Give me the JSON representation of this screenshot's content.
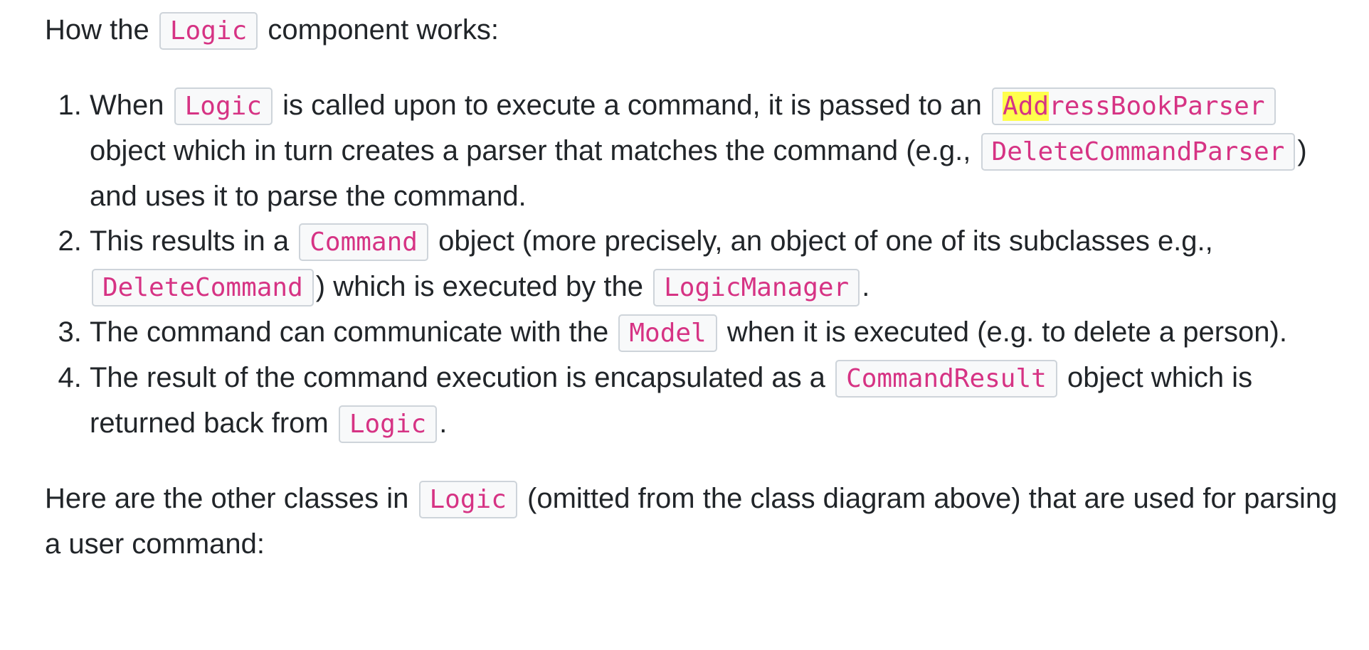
{
  "intro": {
    "before": "How the",
    "code": "Logic",
    "after": "component works:"
  },
  "steps": [
    {
      "t1": "When",
      "c1": "Logic",
      "t2": "is called upon to execute a command, it is passed to an",
      "c2_highlight": "Add",
      "c2_rest": "ressBookParser",
      "t3": "object which in turn creates a parser that matches the command (e.g.,",
      "c3": "DeleteCommandParser",
      "t4": ") and uses it to parse the command."
    },
    {
      "t1": "This results in a",
      "c1": "Command",
      "t2": "object (more precisely, an object of one of its subclasses e.g.,",
      "c2": "DeleteCommand",
      "t3": ") which is executed by the",
      "c3": "LogicManager",
      "t4": "."
    },
    {
      "t1": "The command can communicate with the",
      "c1": "Model",
      "t2": "when it is executed (e.g. to delete a person)."
    },
    {
      "t1": "The result of the command execution is encapsulated as a",
      "c1": "CommandResult",
      "t2": "object which is returned back from",
      "c2": "Logic",
      "t3": "."
    }
  ],
  "outro": {
    "before": "Here are the other classes in",
    "code": "Logic",
    "after": "(omitted from the class diagram above) that are used for parsing a user command:"
  },
  "colors": {
    "text": "#212529",
    "code_text": "#d63384",
    "code_bg": "#f8f9fa",
    "code_border": "#ced4da",
    "highlight": "#ffff4d"
  }
}
